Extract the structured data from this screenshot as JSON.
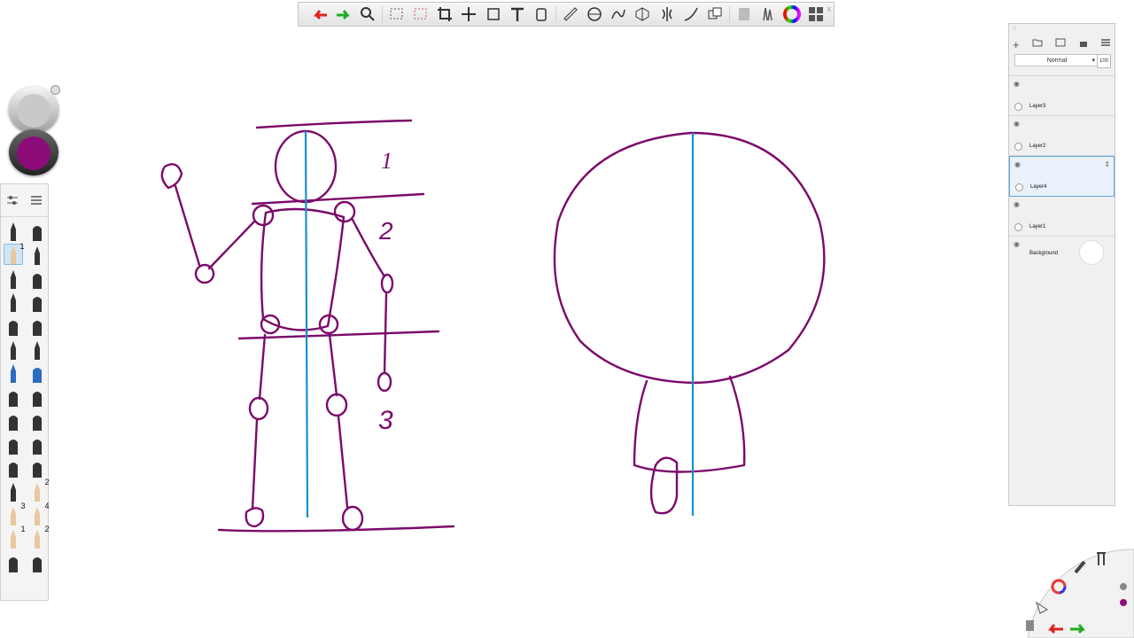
{
  "toolbar": {
    "tools": [
      "undo-icon",
      "redo-icon",
      "zoom-icon",
      "select-icon",
      "select-clear-icon",
      "crop-icon",
      "transform-icon",
      "distort-icon",
      "text-icon",
      "fill-icon",
      "ruler-icon",
      "ellipse-guide-icon",
      "french-curve-icon",
      "perspective-icon",
      "symmetry-icon",
      "stroke-icon",
      "copy-icon",
      "layer-editor-icon",
      "brushes-icon",
      "color-wheel-icon",
      "grid-icon"
    ],
    "close_label": "x"
  },
  "colors": {
    "secondary": "#c9c9c9",
    "primary": "#8c0c78",
    "stroke": "#7b0a6a",
    "guide": "#1a8fd0"
  },
  "brushes": {
    "panel_icons": [
      "brush-settings-icon",
      "brush-list-icon"
    ],
    "items": [
      {
        "name": "pencil",
        "num": ""
      },
      {
        "name": "eraser",
        "num": ""
      },
      {
        "name": "pencil-selected",
        "num": "1"
      },
      {
        "name": "pen",
        "num": ""
      },
      {
        "name": "ballpoint",
        "num": ""
      },
      {
        "name": "marker",
        "num": ""
      },
      {
        "name": "fine-pen",
        "num": ""
      },
      {
        "name": "soft-eraser",
        "num": ""
      },
      {
        "name": "airbrush",
        "num": ""
      },
      {
        "name": "hard-eraser",
        "num": ""
      },
      {
        "name": "felt-tip",
        "num": ""
      },
      {
        "name": "chisel",
        "num": ""
      },
      {
        "name": "blue-pencil",
        "num": ""
      },
      {
        "name": "blue-marker",
        "num": ""
      },
      {
        "name": "small-brush",
        "num": ""
      },
      {
        "name": "round-brush",
        "num": ""
      },
      {
        "name": "paint-brush",
        "num": ""
      },
      {
        "name": "wide-brush",
        "num": ""
      },
      {
        "name": "smudge",
        "num": ""
      },
      {
        "name": "blender",
        "num": ""
      },
      {
        "name": "stamp",
        "num": ""
      },
      {
        "name": "texture",
        "num": ""
      },
      {
        "name": "pen-2",
        "num": ""
      },
      {
        "name": "pencil-2",
        "num": "2"
      },
      {
        "name": "pencil-3",
        "num": "3"
      },
      {
        "name": "pencil-4",
        "num": "4"
      },
      {
        "name": "pencil-5",
        "num": "1"
      },
      {
        "name": "pencil-6",
        "num": "2"
      },
      {
        "name": "splatter",
        "num": ""
      },
      {
        "name": "splatter-2",
        "num": ""
      }
    ]
  },
  "layers": {
    "blend_mode": "Normal",
    "opacity": "100",
    "items": [
      {
        "name": "Layer3",
        "active": false
      },
      {
        "name": "Layer2",
        "active": false
      },
      {
        "name": "Layer4",
        "active": true
      },
      {
        "name": "Layer1",
        "active": false
      }
    ],
    "background": "Background"
  },
  "drawing": {
    "proportion_labels": [
      "1",
      "2",
      "3"
    ]
  }
}
